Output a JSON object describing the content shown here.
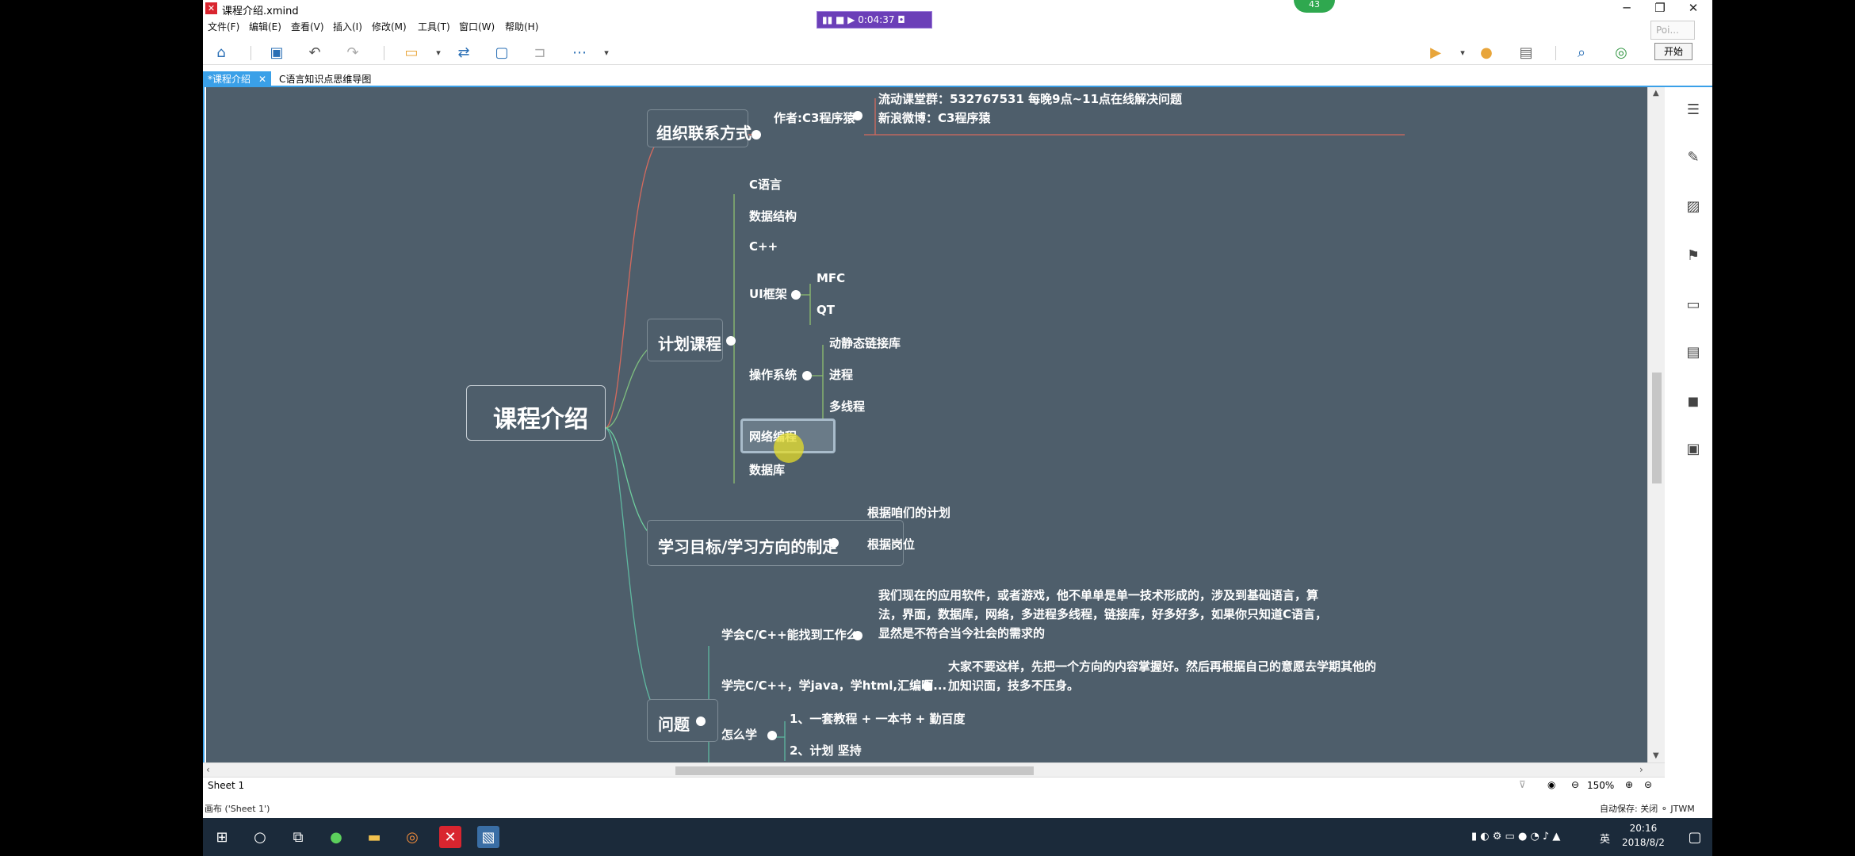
{
  "window": {
    "title": "课程介绍.xmind",
    "minimize": "─",
    "restore": "❐",
    "close": "✕"
  },
  "menu": [
    "文件(F)",
    "编辑(E)",
    "查看(V)",
    "插入(I)",
    "修改(M)",
    "工具(T)",
    "窗口(W)",
    "帮助(H)"
  ],
  "recorder": {
    "time": "▮▮ ■ ▶ 0:04:37 ◘"
  },
  "badge": "43",
  "toolbar": {
    "start_label": "开始",
    "search_placeholder": "Poi..."
  },
  "tabs": [
    {
      "label": "*课程介绍",
      "close": "✕"
    },
    {
      "label": "C语言知识点思维导图"
    }
  ],
  "mindmap": {
    "root": "课程介绍",
    "b1": {
      "label": "组织联系方式",
      "author": "作者:C3程序猿",
      "contact1": "流动课堂群：532767531   每晚9点~11点在线解决问题",
      "contact2": "新浪微博：C3程序猿"
    },
    "b2": {
      "label": "计划课程",
      "items": [
        "C语言",
        "数据结构",
        "C++",
        "UI框架",
        "操作系统",
        "网络编程",
        "数据库"
      ],
      "ui": [
        "MFC",
        "QT"
      ],
      "os": [
        "动静态链接库",
        "进程",
        "多线程"
      ]
    },
    "b3": {
      "label": "学习目标/学习方向的制定",
      "items": [
        "根据咱们的计划",
        "根据岗位"
      ]
    },
    "b4": {
      "label": "问题",
      "q1": "学会C/C++能找到工作么",
      "a1_1": "我们现在的应用软件，或者游戏，他不单单是单一技术形成的，涉及到基础语言，算",
      "a1_2": "法，界面，数据库，网络，多进程多线程，链接库，好多好多，如果你只知道C语言，",
      "a1_3": "显然是不符合当今社会的需求的",
      "q2": "学完C/C++，学java，学html,汇编啊...",
      "a2_1": "大家不要这样，先把一个方向的内容掌握好。然后再根据自己的意愿去学期其他的",
      "a2_2": "加知识面，技多不压身。",
      "q3": "怎么学",
      "a3": [
        "1、一套教程 + 一本书 + 勤百度",
        "2、计划  坚持"
      ]
    }
  },
  "sheet": {
    "name": "Sheet 1",
    "zoom": "150%"
  },
  "status": {
    "left": "画布 ('Sheet 1')",
    "right": "自动保存: 关闭   ⚬ JTWM"
  },
  "clock": {
    "time": "20:16",
    "date": "2018/8/2"
  },
  "ime": "英"
}
